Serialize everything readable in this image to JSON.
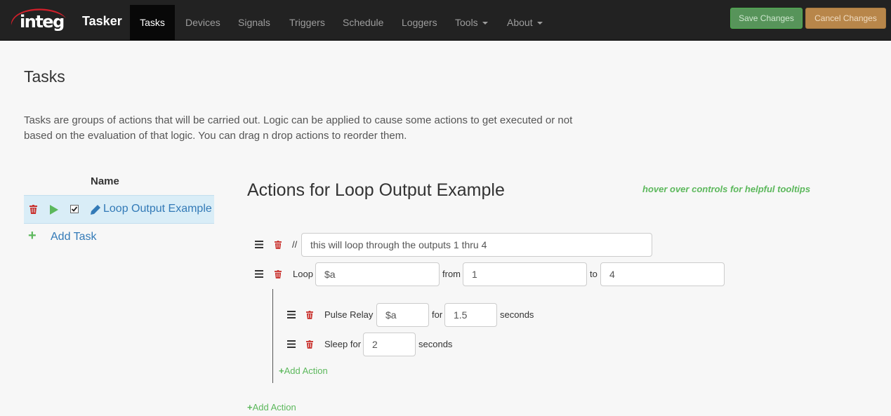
{
  "navbar": {
    "logo_text": "integ",
    "brand": "Tasker",
    "items": [
      {
        "label": "Tasks",
        "active": true
      },
      {
        "label": "Devices"
      },
      {
        "label": "Signals"
      },
      {
        "label": "Triggers"
      },
      {
        "label": "Schedule"
      },
      {
        "label": "Loggers"
      },
      {
        "label": "Tools",
        "dropdown": true
      },
      {
        "label": "About",
        "dropdown": true
      }
    ],
    "save_label": "Save Changes",
    "cancel_label": "Cancel Changes"
  },
  "page": {
    "title": "Tasks",
    "intro": "Tasks are groups of actions that will be carried out. Logic can be applied to cause some actions to get executed or not based on the evaluation of that logic. You can drag n drop actions to reorder them."
  },
  "task_list": {
    "column_header": "Name",
    "tasks": [
      {
        "name": "Loop Output Example",
        "enabled": true,
        "selected": true
      }
    ],
    "add_task_label": "Add Task"
  },
  "actions": {
    "title": "Actions for Loop Output Example",
    "hint": "hover over controls for helpful tooltips",
    "comment_prefix": "//",
    "comment_value": "this will loop through the outputs 1 thru 4",
    "loop": {
      "label": "Loop",
      "var_value": "$a",
      "from_label": "from",
      "from_value": "1",
      "to_label": "to",
      "to_value": "4"
    },
    "pulse": {
      "label": "Pulse Relay",
      "relay_value": "$a",
      "for_label": "for",
      "duration_value": "1.5",
      "unit_label": "seconds"
    },
    "sleep": {
      "label": "Sleep for",
      "value": "2",
      "unit_label": "seconds"
    },
    "inner_add_action": "Add Action",
    "outer_add_action": "Add Action"
  },
  "colors": {
    "navbar_bg": "#222222",
    "link": "#337ab7",
    "success": "#5cb85c",
    "danger": "#c9302c",
    "selected_row": "#d9edf7"
  }
}
